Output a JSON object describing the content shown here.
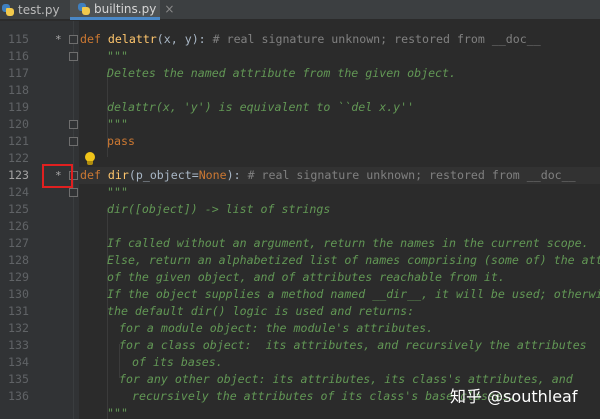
{
  "tabs": [
    {
      "label": "test.py",
      "active": false
    },
    {
      "label": "builtins.py",
      "active": true
    }
  ],
  "tab_close": "×",
  "line_numbers": [
    "115",
    "116",
    "117",
    "118",
    "119",
    "120",
    "121",
    "122",
    "123",
    "124",
    "125",
    "126",
    "127",
    "128",
    "129",
    "130",
    "131",
    "132",
    "133",
    "134",
    "135",
    "136"
  ],
  "current_line": "123",
  "code": {
    "l115": {
      "kw": "def ",
      "fn": "delattr",
      "rest": "(x, y): ",
      "cm": "# real signature unknown; restored from __doc__"
    },
    "l116": "\"\"\"",
    "l117": "Deletes the named attribute from the given object.",
    "l119": "delattr(x, 'y') is equivalent to ``del x.y''",
    "l120": "\"\"\"",
    "l121": "pass",
    "l123": {
      "kw": "def ",
      "fn": "dir",
      "open": "(",
      "param": "p_object",
      "eq": "=",
      "none": "None",
      "close": "): ",
      "cm": "# real signature unknown; restored from __doc__"
    },
    "l124": "\"\"\"",
    "l125": "dir([object]) -> list of strings",
    "l127": "If called without an argument, return the names in the current scope.",
    "l128": "Else, return an alphabetized list of names comprising (some of) the attribut",
    "l129": "of the given object, and of attributes reachable from it.",
    "l130": "If the object supplies a method named __dir__, it will be used; otherwise",
    "l131": "the default dir() logic is used and returns:",
    "l132": "for a module object: the module's attributes.",
    "l133": "for a class object:  its attributes, and recursively the attributes",
    "l134": "of its bases.",
    "l135": "for any other object: its attributes, its class's attributes, and",
    "l136": "recursively the attributes of its class's base classes.",
    "l137": "\"\"\""
  },
  "gutter_marks": {
    "override_star": "*"
  },
  "watermark": "知乎 @southleaf",
  "colors": {
    "background": "#2b2b2b",
    "keyword": "#cc7832",
    "function": "#ffc66d",
    "docstring": "#629755",
    "comment": "#808080",
    "highlight_box": "#e02020"
  }
}
